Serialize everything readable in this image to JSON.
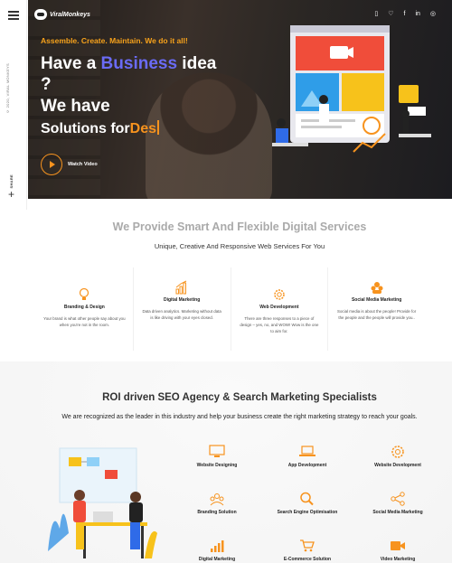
{
  "rail": {
    "copyright": "© 2020, VIRAL MONKEYS",
    "share": "SHARE",
    "plus": "+"
  },
  "brand": {
    "name": "ViralMonkeys"
  },
  "topbar": {
    "icons": [
      "bag-icon",
      "heart-icon",
      "facebook-icon",
      "linkedin-icon",
      "instagram-icon"
    ],
    "glyphs": [
      "▯",
      "♡",
      "f",
      "in",
      "◎"
    ]
  },
  "hero": {
    "tagline": "Assemble. Create. Maintain. We do it all!",
    "line1_pre": "Have a ",
    "line1_accent": "Business",
    "line1_post": " idea",
    "line2": "?",
    "line3": "We have",
    "line4_pre": "Solutions for",
    "line4_typed": "Des",
    "watch_label": "Watch Video",
    "colors": {
      "accent": "#f7931e",
      "blue": "#6a6bf5"
    }
  },
  "services_intro": {
    "title": "We Provide Smart And Flexible Digital Services",
    "subtitle": "Unique, Creative And Responsive Web Services For You"
  },
  "cards": [
    {
      "icon": "lightbulb-icon",
      "title": "Branding & Design",
      "desc": "Your brand is what other people say about you when you're not in the room."
    },
    {
      "icon": "bar-chart-icon",
      "title": "Digital Marketing",
      "desc": "Data driven analytics. Marketing without data is like driving with your eyes closed."
    },
    {
      "icon": "gear-icon",
      "title": "Web Development",
      "desc": "There are three responses to a piece of design – yes, no, and WOW! Wow is the one to aim for."
    },
    {
      "icon": "people-icon",
      "title": "Social Media Marketing",
      "desc": "Social media is about the people! Provide for the people and the people will provide you.."
    }
  ],
  "seo": {
    "title": "ROI driven SEO Agency & Search Marketing Specialists",
    "text": "We are recognized as the leader in this industry and help your business create the right marketing strategy to reach your goals."
  },
  "services": [
    {
      "icon": "monitor-icon",
      "label": "Website Designing"
    },
    {
      "icon": "laptop-icon",
      "label": "App Development"
    },
    {
      "icon": "gear-icon",
      "label": "Website Development"
    },
    {
      "icon": "team-icon",
      "label": "Branding Solution"
    },
    {
      "icon": "search-icon",
      "label": "Search Engine Optimisation"
    },
    {
      "icon": "share-icon",
      "label": "Social Media Marketing"
    },
    {
      "icon": "bar-chart-icon",
      "label": "Digital Marketing"
    },
    {
      "icon": "cart-icon",
      "label": "E-Commerce Solution"
    },
    {
      "icon": "video-icon",
      "label": "Video Marketing"
    }
  ]
}
